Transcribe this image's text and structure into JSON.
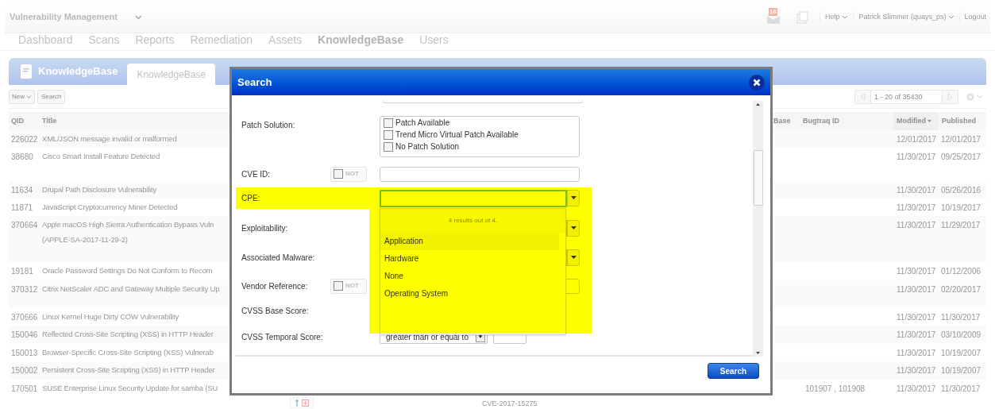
{
  "app_bar": {
    "title": "Vulnerability Management",
    "mail_count": "16",
    "menus": [
      "Help",
      "Patrick Slimmer (quays_ps)"
    ],
    "logout": "Logout"
  },
  "nav": [
    {
      "label": "Dashboard",
      "selected": false
    },
    {
      "label": "Scans",
      "selected": false
    },
    {
      "label": "Reports",
      "selected": false
    },
    {
      "label": "Remediation",
      "selected": false
    },
    {
      "label": "Assets",
      "selected": false
    },
    {
      "label": "KnowledgeBase",
      "selected": true
    },
    {
      "label": "Users",
      "selected": false
    }
  ],
  "module": {
    "title": "KnowledgeBase",
    "tabs": [
      {
        "label": "KnowledgeBase",
        "selected": true
      }
    ]
  },
  "toolbar": {
    "new": "New",
    "search": "Search",
    "pager": "1 - 20 of 35430"
  },
  "table": {
    "columns": [
      {
        "label": "QID",
        "sorted": false
      },
      {
        "label": "Title",
        "sorted": false
      },
      {
        "label": "Base",
        "sorted": false
      },
      {
        "label": "Bugtraq ID",
        "sorted": false
      },
      {
        "label": "Modified",
        "sorted": true
      },
      {
        "label": "Published",
        "sorted": false
      }
    ],
    "rows": [
      {
        "qid": "226022",
        "title": [
          "XML/JSON message invalid or malformed"
        ],
        "modified": "12/01/2017",
        "published": "12/01/2017"
      },
      {
        "qid": "38680",
        "title": [
          "Cisco Smart Install Feature Detected"
        ],
        "modified": "11/30/2017",
        "published": "09/25/2017"
      },
      {
        "qid": "11634",
        "title": [
          "Drupal Path Disclosure Vulnerability"
        ],
        "modified": "11/30/2017",
        "published": "05/26/2016"
      },
      {
        "qid": "11871",
        "title": [
          "JavaScript Cryptocurrency Miner Detected"
        ],
        "modified": "11/30/2017",
        "published": "10/19/2017"
      },
      {
        "qid": "370664",
        "title": [
          "Apple macOS High Sierra Authentication Bypass Vuln",
          "(APPLE-SA-2017-11-29-2)"
        ],
        "modified": "11/30/2017",
        "published": "11/29/2017"
      },
      {
        "qid": "19181",
        "title": [
          "Oracle Password Settings Do Not Conform to Recom"
        ],
        "modified": "11/30/2017",
        "published": "01/12/2006"
      },
      {
        "qid": "370312",
        "title": [
          "Citrix NetScaler ADC and Gateway Multiple Security Up"
        ],
        "modified": "11/30/2017",
        "published": "02/20/2017"
      },
      {
        "qid": "370666",
        "title": [
          "Linux Kernel Huge Dirty COW Vulnerability"
        ],
        "modified": "11/30/2017",
        "published": "11/30/2017"
      },
      {
        "qid": "150046",
        "title": [
          "Reflected Cross-Site Scripting (XSS) in HTTP Header"
        ],
        "modified": "11/30/2017",
        "published": "03/10/2009"
      },
      {
        "qid": "150013",
        "title": [
          "Browser-Specific Cross-Site Scripting (XSS) Vulnerab"
        ],
        "modified": "11/30/2017",
        "published": "10/19/2007"
      },
      {
        "qid": "150002",
        "title": [
          "Persistent Cross-Site Scripting (XSS) in HTTP Header"
        ],
        "modified": "11/30/2017",
        "published": "10/19/2007"
      },
      {
        "qid": "170501",
        "title": [
          "SUSE Enterprise Linux Security Update for samba (SU"
        ],
        "bugtraq": "101907 , 101908",
        "cve": "CVE-2017-15275",
        "modified": "11/30/2017",
        "published": "11/30/2017"
      }
    ]
  },
  "dialog": {
    "title": "Search",
    "fields": [
      {
        "kind": "checklist",
        "label": "Patch Solution:",
        "options": [
          {
            "label": "Patch Available",
            "checked": false
          },
          {
            "label": "Trend Micro Virtual Patch Available",
            "checked": false
          },
          {
            "label": "No Patch Solution",
            "checked": false
          }
        ]
      },
      {
        "kind": "text",
        "label": "CVE ID:",
        "not": {
          "label": "NOT",
          "checked": false
        }
      },
      {
        "kind": "combo",
        "label": "CPE:",
        "highlighted": true,
        "expanded": true,
        "summary": "4 results out of 4.",
        "options": [
          {
            "label": "Application",
            "selected": true
          },
          {
            "label": "Hardware",
            "selected": false
          },
          {
            "label": "None",
            "selected": false
          },
          {
            "label": "Operating System",
            "selected": false
          }
        ]
      },
      {
        "kind": "select",
        "label": "Exploitability:"
      },
      {
        "kind": "select",
        "label": "Associated Malware:"
      },
      {
        "kind": "text",
        "label": "Vendor Reference:",
        "not": {
          "label": "NOT",
          "checked": false
        }
      },
      {
        "kind": "blank",
        "label": "CVSS Base Score:"
      },
      {
        "kind": "score",
        "label": "CVSS Temporal Score:",
        "operator": "greater than or equal to"
      }
    ],
    "submit": "Search"
  }
}
